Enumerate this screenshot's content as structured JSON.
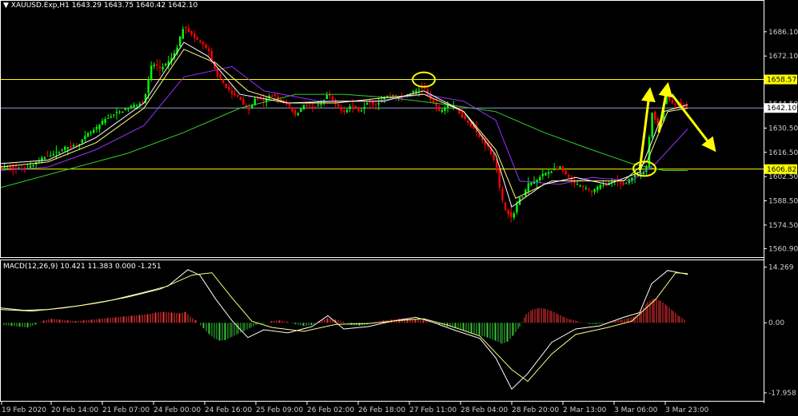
{
  "header": {
    "symbol_line": "XAUUSD.Exp,H1",
    "ohlc": "1643.29 1643.75 1640.42 1642.10",
    "macd_title": "MACD(12,26,9)",
    "macd_values": "10.421 11.383 0.000 -1.251"
  },
  "colors": {
    "background": "#000000",
    "axis": "#ffffff",
    "bull": "#00ff00",
    "bear": "#ff0000",
    "ma_fast": "#ffffff",
    "ma_mid": "#ffff80",
    "ma_slow": "#9b30ff",
    "ma_long": "#32cd32",
    "level": "#ffff00",
    "hline": "#8ea0c8",
    "arrow": "#ffff00",
    "macd_pos": "#ff3333",
    "macd_neg": "#33cc33"
  },
  "chart_data": [
    {
      "type": "candlestick",
      "title": "XAUUSD.Exp,H1",
      "ylim": [
        1556,
        1698
      ],
      "yticks": [
        "1686.10",
        "1672.10",
        "1644.50",
        "1630.50",
        "1616.50",
        "1602.50",
        "1588.50",
        "1574.50",
        "1560.90"
      ],
      "levels": [
        {
          "value": 1658.57,
          "label": "1658.57",
          "color": "yellow"
        },
        {
          "value": 1606.82,
          "label": "1606.82",
          "color": "yellow"
        },
        {
          "value": 1642.1,
          "label": "1642.10",
          "color": "bluegrey"
        }
      ],
      "xticks": [
        "19 Feb 2020",
        "20 Feb 14:00",
        "21 Feb 07:00",
        "24 Feb 00:00",
        "24 Feb 16:00",
        "25 Feb 09:00",
        "26 Feb 02:00",
        "26 Feb 18:00",
        "27 Feb 11:00",
        "28 Feb 04:00",
        "28 Feb 20:00",
        "2 Mar 13:00",
        "3 Mar 06:00",
        "3 Mar 23:00"
      ],
      "price_path": [
        [
          0,
          1608
        ],
        [
          10,
          1608
        ],
        [
          20,
          1607
        ],
        [
          30,
          1607
        ],
        [
          40,
          1609
        ],
        [
          50,
          1612
        ],
        [
          60,
          1615
        ],
        [
          70,
          1616
        ],
        [
          80,
          1619
        ],
        [
          90,
          1620
        ],
        [
          100,
          1622
        ],
        [
          110,
          1627
        ],
        [
          120,
          1630
        ],
        [
          130,
          1635
        ],
        [
          140,
          1638
        ],
        [
          150,
          1640
        ],
        [
          160,
          1642
        ],
        [
          170,
          1644
        ],
        [
          180,
          1646
        ],
        [
          190,
          1668
        ],
        [
          200,
          1665
        ],
        [
          210,
          1668
        ],
        [
          220,
          1675
        ],
        [
          230,
          1690
        ],
        [
          240,
          1684
        ],
        [
          250,
          1680
        ],
        [
          260,
          1676
        ],
        [
          270,
          1662
        ],
        [
          280,
          1656
        ],
        [
          290,
          1650
        ],
        [
          300,
          1648
        ],
        [
          310,
          1640
        ],
        [
          320,
          1648
        ],
        [
          330,
          1646
        ],
        [
          340,
          1650
        ],
        [
          350,
          1646
        ],
        [
          360,
          1644
        ],
        [
          370,
          1638
        ],
        [
          380,
          1644
        ],
        [
          390,
          1642
        ],
        [
          400,
          1644
        ],
        [
          410,
          1650
        ],
        [
          420,
          1644
        ],
        [
          430,
          1640
        ],
        [
          440,
          1644
        ],
        [
          450,
          1640
        ],
        [
          460,
          1646
        ],
        [
          470,
          1644
        ],
        [
          480,
          1648
        ],
        [
          490,
          1650
        ],
        [
          500,
          1648
        ],
        [
          510,
          1650
        ],
        [
          520,
          1652
        ],
        [
          530,
          1654
        ],
        [
          540,
          1646
        ],
        [
          550,
          1640
        ],
        [
          560,
          1644
        ],
        [
          570,
          1642
        ],
        [
          580,
          1636
        ],
        [
          590,
          1632
        ],
        [
          600,
          1625
        ],
        [
          610,
          1620
        ],
        [
          620,
          1610
        ],
        [
          625,
          1595
        ],
        [
          630,
          1585
        ],
        [
          635,
          1582
        ],
        [
          640,
          1578
        ],
        [
          645,
          1585
        ],
        [
          650,
          1590
        ],
        [
          655,
          1592
        ],
        [
          660,
          1598
        ],
        [
          670,
          1600
        ],
        [
          680,
          1604
        ],
        [
          690,
          1606
        ],
        [
          700,
          1608
        ],
        [
          710,
          1602
        ],
        [
          720,
          1598
        ],
        [
          730,
          1596
        ],
        [
          740,
          1594
        ],
        [
          750,
          1597
        ],
        [
          760,
          1598
        ],
        [
          770,
          1600
        ],
        [
          780,
          1598
        ],
        [
          790,
          1602
        ],
        [
          800,
          1604
        ],
        [
          808,
          1606
        ],
        [
          815,
          1640
        ],
        [
          825,
          1630
        ],
        [
          832,
          1650
        ],
        [
          840,
          1645
        ],
        [
          850,
          1644
        ],
        [
          860,
          1642
        ]
      ],
      "ma_fast": [
        [
          0,
          1610
        ],
        [
          60,
          1612
        ],
        [
          120,
          1625
        ],
        [
          180,
          1645
        ],
        [
          230,
          1680
        ],
        [
          260,
          1672
        ],
        [
          300,
          1650
        ],
        [
          360,
          1645
        ],
        [
          420,
          1646
        ],
        [
          480,
          1646
        ],
        [
          530,
          1652
        ],
        [
          580,
          1640
        ],
        [
          620,
          1615
        ],
        [
          640,
          1585
        ],
        [
          680,
          1598
        ],
        [
          720,
          1602
        ],
        [
          760,
          1598
        ],
        [
          800,
          1605
        ],
        [
          830,
          1640
        ],
        [
          860,
          1644
        ]
      ],
      "ma_mid": [
        [
          0,
          1608
        ],
        [
          60,
          1611
        ],
        [
          120,
          1622
        ],
        [
          180,
          1642
        ],
        [
          230,
          1676
        ],
        [
          270,
          1668
        ],
        [
          310,
          1652
        ],
        [
          360,
          1645
        ],
        [
          420,
          1645
        ],
        [
          480,
          1648
        ],
        [
          530,
          1650
        ],
        [
          580,
          1640
        ],
        [
          620,
          1618
        ],
        [
          645,
          1590
        ],
        [
          690,
          1600
        ],
        [
          730,
          1600
        ],
        [
          780,
          1600
        ],
        [
          810,
          1612
        ],
        [
          835,
          1640
        ],
        [
          860,
          1642
        ]
      ],
      "ma_slow": [
        [
          0,
          1606
        ],
        [
          60,
          1608
        ],
        [
          120,
          1618
        ],
        [
          180,
          1632
        ],
        [
          230,
          1660
        ],
        [
          290,
          1666
        ],
        [
          330,
          1652
        ],
        [
          400,
          1646
        ],
        [
          470,
          1646
        ],
        [
          530,
          1650
        ],
        [
          580,
          1646
        ],
        [
          620,
          1635
        ],
        [
          650,
          1600
        ],
        [
          700,
          1598
        ],
        [
          740,
          1602
        ],
        [
          790,
          1600
        ],
        [
          820,
          1610
        ],
        [
          860,
          1630
        ]
      ],
      "ma_long": [
        [
          0,
          1596
        ],
        [
          80,
          1606
        ],
        [
          160,
          1616
        ],
        [
          230,
          1628
        ],
        [
          300,
          1642
        ],
        [
          370,
          1650
        ],
        [
          430,
          1650
        ],
        [
          490,
          1648
        ],
        [
          560,
          1644
        ],
        [
          620,
          1640
        ],
        [
          680,
          1628
        ],
        [
          740,
          1618
        ],
        [
          790,
          1610
        ],
        [
          830,
          1606
        ],
        [
          860,
          1606
        ]
      ]
    },
    {
      "type": "macd",
      "title": "MACD(12,26,9)",
      "ylim": [
        -20,
        16
      ],
      "yticks": [
        "14.269",
        "0.00",
        "-17.958"
      ],
      "histogram": [
        [
          5,
          -0.6
        ],
        [
          15,
          -0.8
        ],
        [
          25,
          -1.0
        ],
        [
          35,
          -1.2
        ],
        [
          45,
          -0.4
        ],
        [
          55,
          0.6
        ],
        [
          65,
          1.0
        ],
        [
          75,
          0.8
        ],
        [
          85,
          0.6
        ],
        [
          95,
          0.4
        ],
        [
          105,
          0.6
        ],
        [
          115,
          0.8
        ],
        [
          125,
          1.0
        ],
        [
          135,
          1.2
        ],
        [
          145,
          1.4
        ],
        [
          155,
          1.6
        ],
        [
          165,
          1.8
        ],
        [
          175,
          2.0
        ],
        [
          185,
          2.2
        ],
        [
          195,
          2.6
        ],
        [
          205,
          2.8
        ],
        [
          215,
          2.6
        ],
        [
          225,
          2.4
        ],
        [
          232,
          2.8
        ],
        [
          238,
          1.6
        ],
        [
          245,
          0.6
        ],
        [
          255,
          -1.5
        ],
        [
          262,
          -3.0
        ],
        [
          268,
          -4.0
        ],
        [
          275,
          -4.6
        ],
        [
          282,
          -4.4
        ],
        [
          290,
          -3.6
        ],
        [
          298,
          -2.8
        ],
        [
          306,
          -2.0
        ],
        [
          314,
          -1.2
        ],
        [
          322,
          -0.4
        ],
        [
          330,
          -0.2
        ],
        [
          340,
          0.4
        ],
        [
          350,
          0.6
        ],
        [
          360,
          0.2
        ],
        [
          370,
          -0.4
        ],
        [
          380,
          -0.8
        ],
        [
          390,
          -0.6
        ],
        [
          400,
          0.4
        ],
        [
          410,
          1.2
        ],
        [
          420,
          0.8
        ],
        [
          430,
          0.2
        ],
        [
          440,
          -0.6
        ],
        [
          450,
          -0.8
        ],
        [
          460,
          -0.4
        ],
        [
          470,
          0.2
        ],
        [
          480,
          0.6
        ],
        [
          490,
          0.8
        ],
        [
          500,
          1.0
        ],
        [
          510,
          1.2
        ],
        [
          520,
          1.0
        ],
        [
          530,
          0.6
        ],
        [
          540,
          0.0
        ],
        [
          550,
          -0.6
        ],
        [
          560,
          -1.0
        ],
        [
          570,
          -1.4
        ],
        [
          580,
          -2.0
        ],
        [
          590,
          -2.6
        ],
        [
          600,
          -3.2
        ],
        [
          610,
          -3.8
        ],
        [
          620,
          -4.6
        ],
        [
          628,
          -5.4
        ],
        [
          635,
          -4.8
        ],
        [
          642,
          -3.2
        ],
        [
          650,
          -1.0
        ],
        [
          658,
          2.2
        ],
        [
          666,
          3.4
        ],
        [
          674,
          3.8
        ],
        [
          682,
          3.6
        ],
        [
          690,
          3.0
        ],
        [
          698,
          2.2
        ],
        [
          706,
          1.4
        ],
        [
          714,
          0.8
        ],
        [
          722,
          0.4
        ],
        [
          730,
          0.0
        ],
        [
          738,
          -0.3
        ],
        [
          746,
          -0.4
        ],
        [
          754,
          -0.2
        ],
        [
          762,
          0.2
        ],
        [
          770,
          0.6
        ],
        [
          778,
          0.8
        ],
        [
          786,
          1.2
        ],
        [
          794,
          1.6
        ],
        [
          802,
          3.0
        ],
        [
          810,
          5.4
        ],
        [
          818,
          6.2
        ],
        [
          826,
          5.6
        ],
        [
          834,
          4.4
        ],
        [
          842,
          3.0
        ],
        [
          850,
          1.6
        ],
        [
          858,
          0.6
        ]
      ],
      "macd_line": [
        [
          0,
          3.8
        ],
        [
          30,
          3.2
        ],
        [
          60,
          3.4
        ],
        [
          100,
          4.4
        ],
        [
          140,
          5.8
        ],
        [
          180,
          7.8
        ],
        [
          210,
          9.4
        ],
        [
          235,
          13.6
        ],
        [
          250,
          12.2
        ],
        [
          270,
          6.0
        ],
        [
          290,
          0.6
        ],
        [
          310,
          -3.8
        ],
        [
          330,
          -1.8
        ],
        [
          360,
          -2.6
        ],
        [
          390,
          -1.0
        ],
        [
          410,
          1.8
        ],
        [
          430,
          -1.6
        ],
        [
          460,
          -1.0
        ],
        [
          490,
          0.4
        ],
        [
          520,
          1.4
        ],
        [
          540,
          0.2
        ],
        [
          570,
          -2.0
        ],
        [
          600,
          -4.0
        ],
        [
          620,
          -9.0
        ],
        [
          640,
          -17.0
        ],
        [
          660,
          -13.0
        ],
        [
          690,
          -5.0
        ],
        [
          720,
          -1.6
        ],
        [
          750,
          -0.8
        ],
        [
          780,
          1.4
        ],
        [
          800,
          2.6
        ],
        [
          815,
          10.0
        ],
        [
          835,
          13.4
        ],
        [
          860,
          12.4
        ]
      ],
      "signal_line": [
        [
          0,
          3.4
        ],
        [
          40,
          3.0
        ],
        [
          80,
          3.8
        ],
        [
          120,
          5.0
        ],
        [
          160,
          6.6
        ],
        [
          200,
          8.6
        ],
        [
          240,
          12.2
        ],
        [
          265,
          12.8
        ],
        [
          290,
          6.4
        ],
        [
          315,
          0.4
        ],
        [
          340,
          -1.2
        ],
        [
          380,
          -2.2
        ],
        [
          420,
          -0.4
        ],
        [
          460,
          -0.2
        ],
        [
          500,
          0.6
        ],
        [
          530,
          1.0
        ],
        [
          560,
          -0.6
        ],
        [
          600,
          -3.4
        ],
        [
          640,
          -12.0
        ],
        [
          660,
          -15.0
        ],
        [
          690,
          -8.0
        ],
        [
          720,
          -3.0
        ],
        [
          760,
          -1.2
        ],
        [
          790,
          0.4
        ],
        [
          820,
          6.0
        ],
        [
          845,
          12.8
        ],
        [
          860,
          12.6
        ]
      ]
    }
  ],
  "annotations": {
    "circles": [
      {
        "x": 530,
        "value": 1658.5
      },
      {
        "x": 806,
        "value": 1607
      }
    ],
    "arrows": [
      {
        "from": [
          800,
          1606
        ],
        "to": [
          812,
          1650
        ]
      },
      {
        "from": [
          824,
          1628
        ],
        "to": [
          834,
          1653
        ]
      },
      {
        "from": [
          840,
          1650
        ],
        "to": [
          890,
          1620
        ]
      }
    ]
  }
}
